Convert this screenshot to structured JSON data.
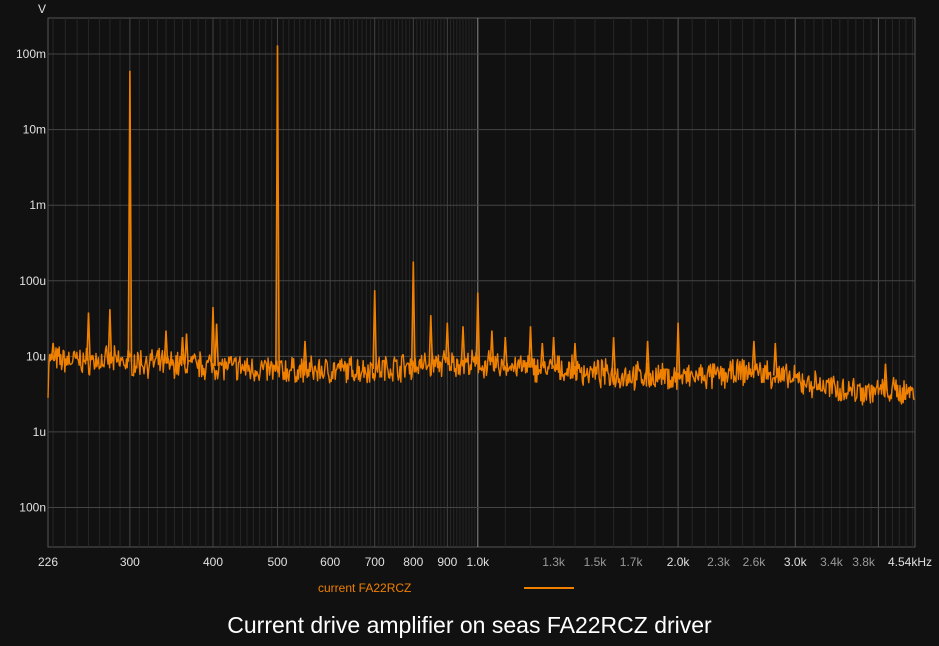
{
  "chart_data": {
    "type": "line",
    "title": "Current drive amplifier on seas FA22RCZ driver",
    "ylabel": "V",
    "xlabel": "",
    "x_scale": "log",
    "y_scale": "log",
    "xlim": [
      226,
      4540
    ],
    "ylim": [
      3e-08,
      0.3
    ],
    "grid": true,
    "legend_position": "bottom-center",
    "y_ticks": [
      {
        "value": 0.1,
        "label": "100m"
      },
      {
        "value": 0.01,
        "label": "10m"
      },
      {
        "value": 0.001,
        "label": "1m"
      },
      {
        "value": 0.0001,
        "label": "100u"
      },
      {
        "value": 1e-05,
        "label": "10u"
      },
      {
        "value": 1e-06,
        "label": "1u"
      },
      {
        "value": 1e-07,
        "label": "100n"
      }
    ],
    "x_ticks": [
      {
        "value": 226,
        "label": "226",
        "major": true
      },
      {
        "value": 300,
        "label": "300",
        "major": true
      },
      {
        "value": 400,
        "label": "400",
        "major": true
      },
      {
        "value": 500,
        "label": "500",
        "major": true
      },
      {
        "value": 600,
        "label": "600",
        "major": true
      },
      {
        "value": 700,
        "label": "700",
        "major": true
      },
      {
        "value": 800,
        "label": "800",
        "major": true
      },
      {
        "value": 900,
        "label": "900",
        "major": true
      },
      {
        "value": 1000,
        "label": "1.0k",
        "major": true
      },
      {
        "value": 1300,
        "label": "1.3k",
        "major": false
      },
      {
        "value": 1500,
        "label": "1.5k",
        "major": false
      },
      {
        "value": 1700,
        "label": "1.7k",
        "major": false
      },
      {
        "value": 2000,
        "label": "2.0k",
        "major": true
      },
      {
        "value": 2300,
        "label": "2.3k",
        "major": false
      },
      {
        "value": 2600,
        "label": "2.6k",
        "major": false
      },
      {
        "value": 3000,
        "label": "3.0k",
        "major": true
      },
      {
        "value": 3400,
        "label": "3.4k",
        "major": false
      },
      {
        "value": 3800,
        "label": "3.8k",
        "major": false
      },
      {
        "value": 4540,
        "label": "4.54kHz",
        "major": true
      }
    ],
    "series": [
      {
        "name": "current FA22RCZ",
        "color": "#f08000",
        "noise_floor": [
          {
            "f": 226,
            "v": 9e-06
          },
          {
            "f": 300,
            "v": 8.5e-06
          },
          {
            "f": 400,
            "v": 7.5e-06
          },
          {
            "f": 500,
            "v": 6.5e-06
          },
          {
            "f": 600,
            "v": 6.5e-06
          },
          {
            "f": 700,
            "v": 6.8e-06
          },
          {
            "f": 800,
            "v": 7.5e-06
          },
          {
            "f": 900,
            "v": 8.2e-06
          },
          {
            "f": 1000,
            "v": 7.8e-06
          },
          {
            "f": 1300,
            "v": 6.8e-06
          },
          {
            "f": 1500,
            "v": 6e-06
          },
          {
            "f": 1700,
            "v": 5.5e-06
          },
          {
            "f": 2000,
            "v": 5.2e-06
          },
          {
            "f": 2300,
            "v": 5.5e-06
          },
          {
            "f": 2600,
            "v": 6.5e-06
          },
          {
            "f": 3000,
            "v": 4.8e-06
          },
          {
            "f": 3400,
            "v": 3.8e-06
          },
          {
            "f": 3800,
            "v": 3.5e-06
          },
          {
            "f": 4540,
            "v": 3.4e-06
          }
        ],
        "peaks": [
          {
            "f": 230,
            "v": 1.5e-05
          },
          {
            "f": 260,
            "v": 3.8e-05
          },
          {
            "f": 280,
            "v": 4.2e-05
          },
          {
            "f": 300,
            "v": 0.06
          },
          {
            "f": 340,
            "v": 2.2e-05
          },
          {
            "f": 360,
            "v": 1.8e-05
          },
          {
            "f": 365,
            "v": 2e-05
          },
          {
            "f": 400,
            "v": 4.5e-05
          },
          {
            "f": 405,
            "v": 2.7e-05
          },
          {
            "f": 500,
            "v": 0.13
          },
          {
            "f": 550,
            "v": 1.6e-05
          },
          {
            "f": 700,
            "v": 7.5e-05
          },
          {
            "f": 800,
            "v": 0.00018
          },
          {
            "f": 850,
            "v": 3.5e-05
          },
          {
            "f": 900,
            "v": 2.8e-05
          },
          {
            "f": 950,
            "v": 2.5e-05
          },
          {
            "f": 1000,
            "v": 7e-05
          },
          {
            "f": 1050,
            "v": 2.2e-05
          },
          {
            "f": 1100,
            "v": 1.8e-05
          },
          {
            "f": 1200,
            "v": 2.5e-05
          },
          {
            "f": 1250,
            "v": 1.5e-05
          },
          {
            "f": 1300,
            "v": 1.8e-05
          },
          {
            "f": 1400,
            "v": 1.5e-05
          },
          {
            "f": 1600,
            "v": 1.8e-05
          },
          {
            "f": 1800,
            "v": 1.6e-05
          },
          {
            "f": 2000,
            "v": 2.8e-05
          },
          {
            "f": 2600,
            "v": 1.6e-05
          },
          {
            "f": 2800,
            "v": 1.5e-05
          },
          {
            "f": 4100,
            "v": 8e-06
          }
        ]
      }
    ]
  }
}
